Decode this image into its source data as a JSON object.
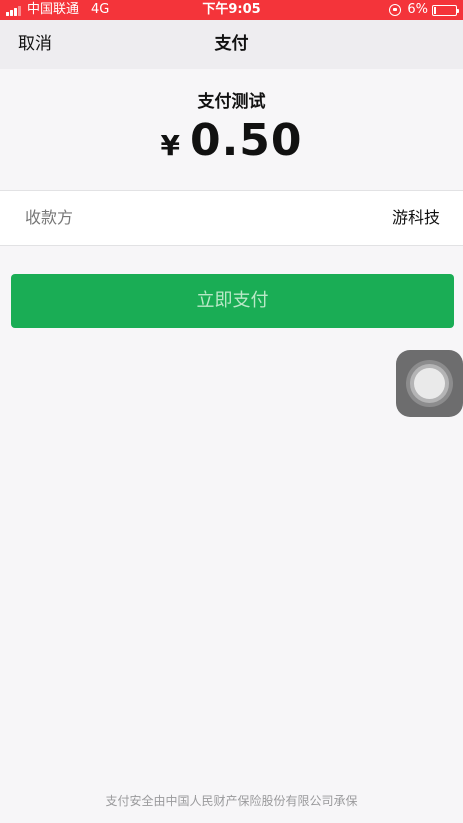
{
  "status_bar": {
    "carrier": "中国联通",
    "network": "4G",
    "time": "下午9:05",
    "battery_percent": "6%"
  },
  "navbar": {
    "cancel_label": "取消",
    "title": "支付"
  },
  "payment": {
    "product_name": "支付测试",
    "currency_symbol": "¥",
    "amount": "0.50",
    "payee_label": "收款方",
    "payee_value": "游科技",
    "pay_button_label": "立即支付"
  },
  "footer": {
    "text": "支付安全由中国人民财产保险股份有限公司承保"
  },
  "colors": {
    "status_bar_bg": "#f4343a",
    "pay_button_bg": "#1aad55",
    "pay_button_text": "#b9e8c7"
  },
  "icons": {
    "signal": "signal-icon",
    "orientation_lock": "orientation-lock-icon",
    "battery": "battery-icon",
    "assistive_touch": "assistive-touch-icon"
  }
}
